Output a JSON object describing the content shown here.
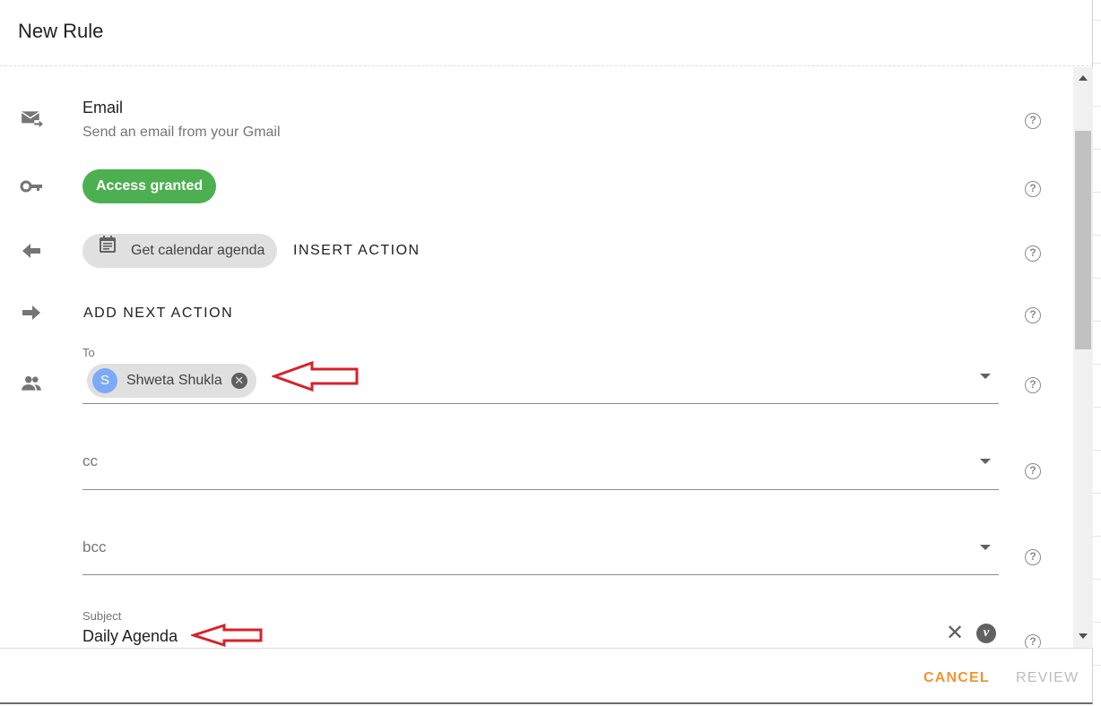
{
  "dialog": {
    "title": "New Rule"
  },
  "action": {
    "name": "Email",
    "description": "Send an email from your Gmail",
    "icon": "email-send-icon"
  },
  "access": {
    "label": "Access granted",
    "icon": "key-icon",
    "color": "#4caf50"
  },
  "insert": {
    "chip_label": "Get calendar agenda",
    "chip_icon": "calendar-icon",
    "insert_label": "INSERT ACTION",
    "icon": "arrow-left-icon"
  },
  "next": {
    "label": "ADD NEXT ACTION",
    "icon": "arrow-right-icon"
  },
  "to_field": {
    "label": "To",
    "icon": "people-icon",
    "recipients": [
      {
        "initial": "S",
        "name": "Shweta Shukla"
      }
    ]
  },
  "cc_field": {
    "placeholder": "cc"
  },
  "bcc_field": {
    "placeholder": "bcc"
  },
  "subject_field": {
    "label": "Subject",
    "value": "Daily Agenda",
    "variable_icon_label": "v"
  },
  "help_icon_glyph": "?",
  "footer": {
    "cancel_label": "CANCEL",
    "review_label": "REVIEW",
    "cancel_color": "#f0962f"
  }
}
